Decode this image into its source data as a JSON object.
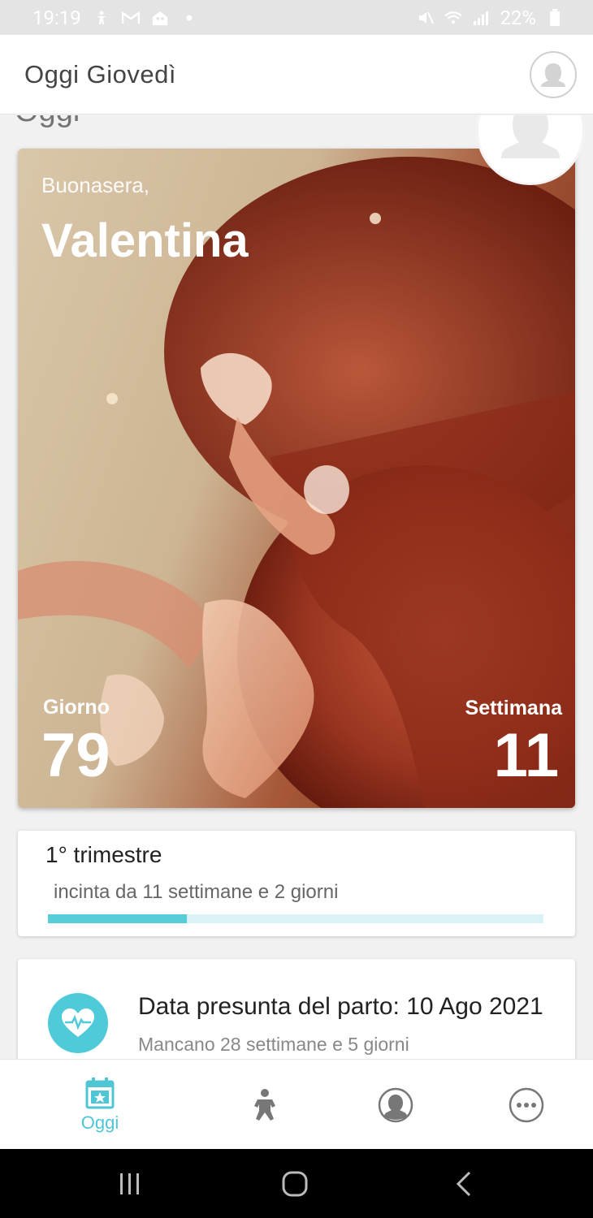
{
  "status_bar": {
    "time": "19:19",
    "battery": "22%",
    "icons": [
      "accessibility-icon",
      "gmail-icon",
      "family-icon",
      "dot-icon",
      "mute-icon",
      "wifi-icon",
      "signal-icon",
      "battery-icon"
    ]
  },
  "header": {
    "title": "Oggi Giovedì",
    "avatar_icon": "user-avatar-icon"
  },
  "hero": {
    "ghost_title": "Oggi",
    "greeting": "Buonasera,",
    "name": "Valentina",
    "day_label": "Giorno",
    "day_value": "79",
    "week_label": "Settimana",
    "week_value": "11"
  },
  "trimester": {
    "title": "1° trimestre",
    "subtitle": "incinta da 11 settimane e 2 giorni",
    "progress": 0.28
  },
  "due_date": {
    "title": "Data presunta del parto: 10 Ago 2021",
    "subtitle": "Mancano 28 settimane e 5 giorni",
    "icon": "heartbeat-icon"
  },
  "bottom_nav": {
    "items": [
      {
        "label": "Oggi",
        "icon": "calendar-star-icon",
        "active": true
      },
      {
        "label": "",
        "icon": "baby-icon",
        "active": false
      },
      {
        "label": "",
        "icon": "mother-avatar-icon",
        "active": false
      },
      {
        "label": "",
        "icon": "more-icon",
        "active": false
      }
    ]
  },
  "colors": {
    "accent": "#4fc6d4",
    "progress_track": "#d9f2f5",
    "progress_fill": "#57cdd9"
  }
}
